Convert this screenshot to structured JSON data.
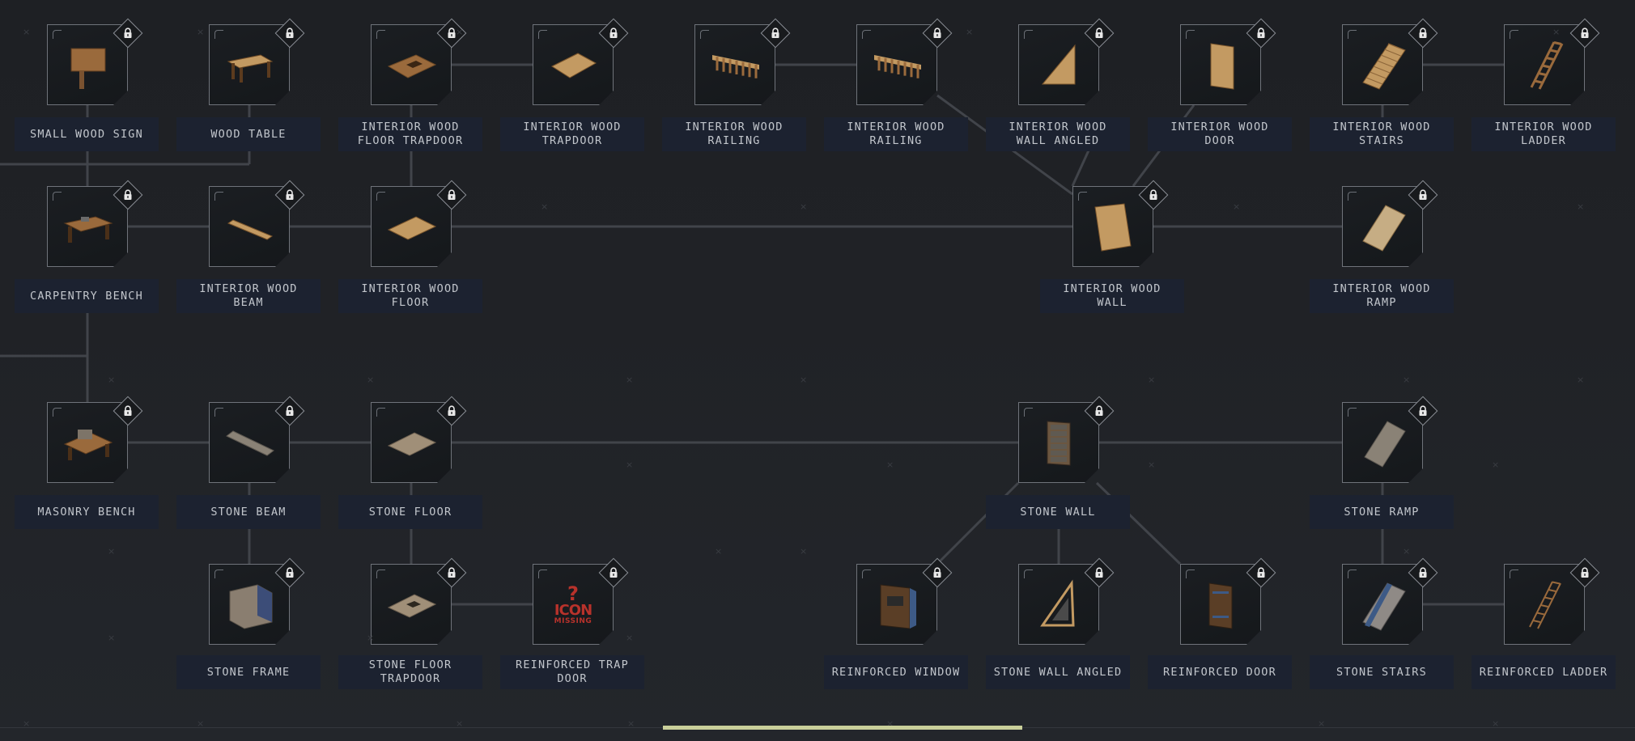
{
  "colors": {
    "background": "#202226",
    "label_bg": "#1c2230",
    "line": "#41444a",
    "progress": "#c9cf9a",
    "missing": "#b8322b"
  },
  "lock_icon": "padlock-icon",
  "nodes": [
    {
      "id": "small-wood-sign",
      "label": "SMALL WOOD SIGN",
      "icon": "wood-sign-icon",
      "locked": true
    },
    {
      "id": "wood-table",
      "label": "WOOD TABLE",
      "icon": "wood-table-icon",
      "locked": true
    },
    {
      "id": "interior-wood-floor-trapdoor",
      "label": "INTERIOR WOOD FLOOR TRAPDOOR",
      "icon": "floor-trapdoor-icon",
      "locked": true
    },
    {
      "id": "interior-wood-trapdoor",
      "label": "INTERIOR WOOD TRAPDOOR",
      "icon": "trapdoor-icon",
      "locked": true
    },
    {
      "id": "interior-wood-railing-1",
      "label": "INTERIOR WOOD RAILING",
      "icon": "railing-icon",
      "locked": true
    },
    {
      "id": "interior-wood-railing-2",
      "label": "INTERIOR WOOD RAILING",
      "icon": "railing-icon",
      "locked": true
    },
    {
      "id": "interior-wood-wall-angled",
      "label": "INTERIOR WOOD WALL ANGLED",
      "icon": "angled-wall-icon",
      "locked": true
    },
    {
      "id": "interior-wood-door",
      "label": "INTERIOR WOOD DOOR",
      "icon": "wood-door-icon",
      "locked": true
    },
    {
      "id": "interior-wood-stairs",
      "label": "INTERIOR WOOD STAIRS",
      "icon": "wood-stairs-icon",
      "locked": true
    },
    {
      "id": "interior-wood-ladder",
      "label": "INTERIOR WOOD LADDER",
      "icon": "wood-ladder-icon",
      "locked": true
    },
    {
      "id": "carpentry-bench",
      "label": "CARPENTRY BENCH",
      "icon": "carpentry-bench-icon",
      "locked": true
    },
    {
      "id": "interior-wood-beam",
      "label": "INTERIOR WOOD BEAM",
      "icon": "wood-beam-icon",
      "locked": true
    },
    {
      "id": "interior-wood-floor",
      "label": "INTERIOR WOOD FLOOR",
      "icon": "wood-floor-icon",
      "locked": true
    },
    {
      "id": "interior-wood-wall",
      "label": "INTERIOR WOOD WALL",
      "icon": "wood-wall-icon",
      "locked": true
    },
    {
      "id": "interior-wood-ramp",
      "label": "INTERIOR WOOD RAMP",
      "icon": "wood-ramp-icon",
      "locked": true
    },
    {
      "id": "masonry-bench",
      "label": "MASONRY BENCH",
      "icon": "masonry-bench-icon",
      "locked": true
    },
    {
      "id": "stone-beam",
      "label": "STONE BEAM",
      "icon": "stone-beam-icon",
      "locked": true
    },
    {
      "id": "stone-floor",
      "label": "STONE FLOOR",
      "icon": "stone-floor-icon",
      "locked": true
    },
    {
      "id": "stone-wall",
      "label": "STONE WALL",
      "icon": "stone-wall-icon",
      "locked": true
    },
    {
      "id": "stone-ramp",
      "label": "STONE RAMP",
      "icon": "stone-ramp-icon",
      "locked": true
    },
    {
      "id": "stone-frame",
      "label": "STONE FRAME",
      "icon": "stone-frame-icon",
      "locked": true
    },
    {
      "id": "stone-floor-trapdoor",
      "label": "STONE FLOOR TRAPDOOR",
      "icon": "stone-trapdoor-icon",
      "locked": true
    },
    {
      "id": "reinforced-trap-door",
      "label": "REINFORCED TRAP DOOR",
      "icon": "icon-missing",
      "icon_text": {
        "q": "?",
        "t1": "ICON",
        "t2": "MISSING"
      },
      "locked": true
    },
    {
      "id": "reinforced-window",
      "label": "REINFORCED WINDOW",
      "icon": "reinforced-window-icon",
      "locked": true
    },
    {
      "id": "stone-wall-angled",
      "label": "STONE WALL ANGLED",
      "icon": "stone-angled-wall-icon",
      "locked": true
    },
    {
      "id": "reinforced-door",
      "label": "REINFORCED DOOR",
      "icon": "reinforced-door-icon",
      "locked": true
    },
    {
      "id": "stone-stairs",
      "label": "STONE STAIRS",
      "icon": "stone-stairs-icon",
      "locked": true
    },
    {
      "id": "reinforced-ladder",
      "label": "REINFORCED LADDER",
      "icon": "reinforced-ladder-icon",
      "locked": true
    }
  ],
  "scroll": {
    "position_fraction": 0.52,
    "visible_fraction": 0.22
  }
}
